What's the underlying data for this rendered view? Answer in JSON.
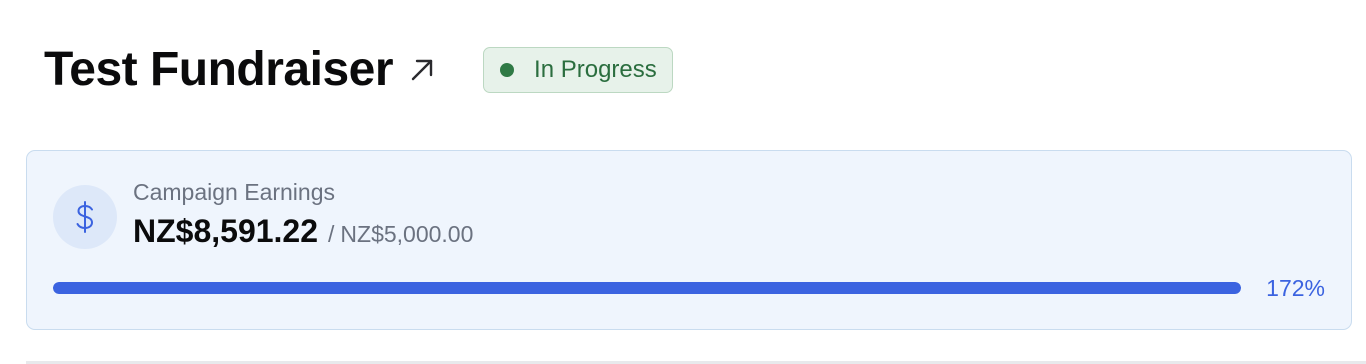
{
  "header": {
    "title": "Test Fundraiser",
    "external_link_icon": "arrow-up-right-icon"
  },
  "status_badge": {
    "label": "In Progress",
    "color": "#2f7a45"
  },
  "earnings_card": {
    "icon": "dollar-icon",
    "label": "Campaign Earnings",
    "amount": "NZ$8,591.22",
    "separator": "/",
    "goal": "NZ$5,000.00",
    "progress_percent_label": "172%",
    "progress_fraction": 1.72,
    "accent_color": "#3b63e0"
  }
}
